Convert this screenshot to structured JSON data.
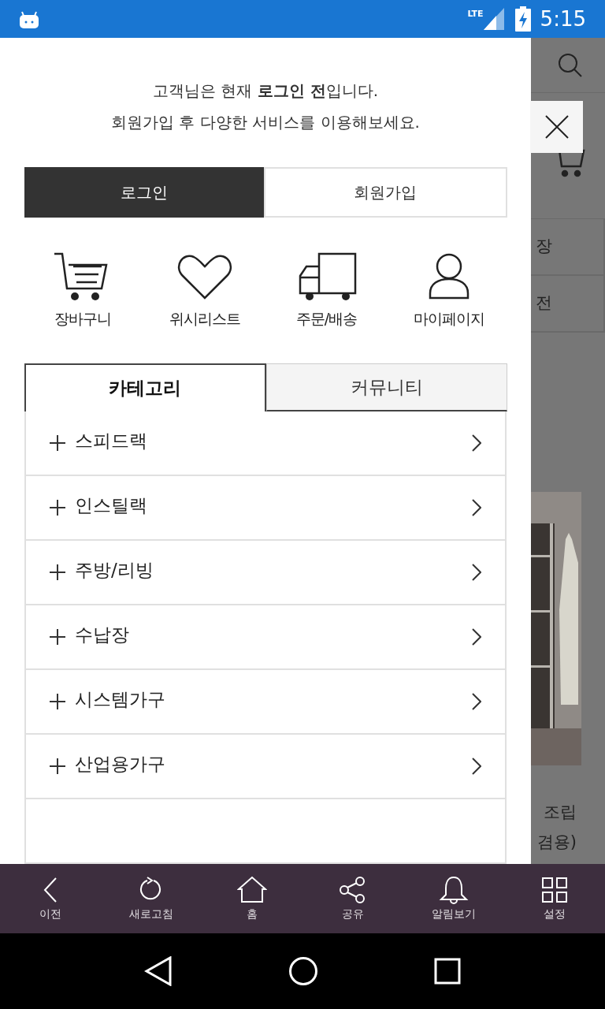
{
  "status_bar": {
    "network": "LTE",
    "time": "5:15"
  },
  "drawer": {
    "notice_lines": [
      "고객님은 현재 **로그인 전**입니다.",
      "회원가입 후 다양한 서비스를 이용해보세요."
    ],
    "auth_buttons": [
      {
        "label": "로그인",
        "kind": "primary"
      },
      {
        "label": "회원가입",
        "kind": "secondary"
      }
    ],
    "shortcuts": [
      {
        "label": "장바구니",
        "kind": "cart"
      },
      {
        "label": "위시리스트",
        "kind": "heart"
      },
      {
        "label": "주문/배송",
        "kind": "truck"
      },
      {
        "label": "마이페이지",
        "kind": "person"
      }
    ],
    "tabs": [
      {
        "label": "카테고리",
        "selected": true
      },
      {
        "label": "커뮤니티",
        "selected": false
      }
    ],
    "categories": [
      {
        "label": "스피드랙"
      },
      {
        "label": "인스틸랙"
      },
      {
        "label": "주방/리빙"
      },
      {
        "label": "수납장"
      },
      {
        "label": "시스템가구"
      },
      {
        "label": "산업용가구"
      }
    ]
  },
  "background_page": {
    "menu_items": [
      "장",
      "전"
    ],
    "product_title_lines": [
      "조립",
      "겸용)"
    ]
  },
  "bottom_nav": [
    {
      "label": "이전",
      "kind": "back"
    },
    {
      "label": "새로고침",
      "kind": "refresh"
    },
    {
      "label": "홈",
      "kind": "home"
    },
    {
      "label": "공유",
      "kind": "share"
    },
    {
      "label": "알림보기",
      "kind": "bell"
    },
    {
      "label": "설정",
      "kind": "grid"
    }
  ]
}
